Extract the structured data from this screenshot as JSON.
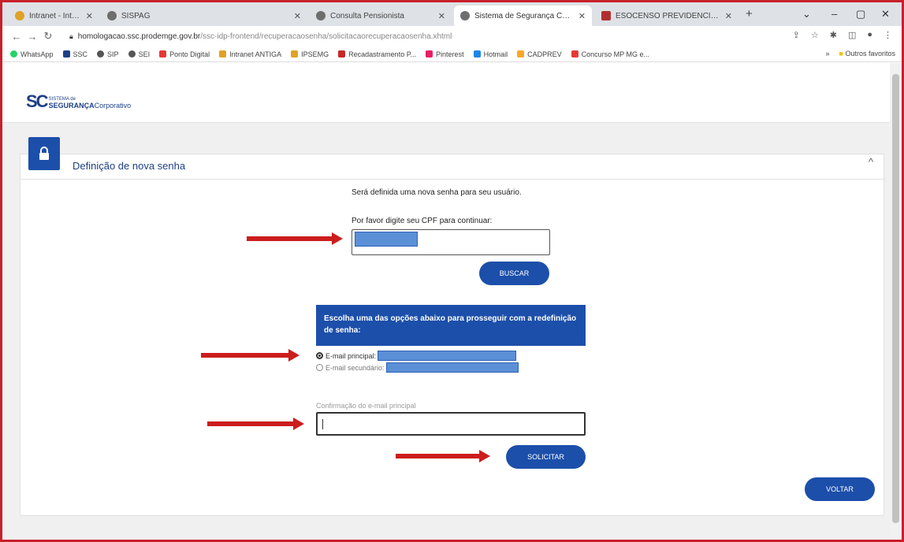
{
  "browser": {
    "tabs": [
      {
        "label": "Intranet - Intranet - Banda dkn",
        "color": "#e0a126"
      },
      {
        "label": "SISPAG",
        "color": "#6e6e6e"
      },
      {
        "label": "Consulta Pensionista",
        "color": "#6e6e6e"
      },
      {
        "label": "Sistema de Segurança Corpora",
        "color": "#6e6e6e"
      },
      {
        "label": "ESOCENSO PREVIDENCIARIO",
        "color": "#b03030"
      }
    ],
    "new_tab": "+",
    "window_controls": {
      "dropdown": "⌄",
      "minimize": "–",
      "maximize": "▢",
      "close": "✕"
    },
    "url_host": "homologacao.ssc.prodemge.gov.br",
    "url_path": "/ssc-idp-frontend/recuperacaosenha/solicitacaorecuperacaosenha.xhtml",
    "bookmarks": [
      {
        "label": "WhatsApp",
        "color": "#25d366"
      },
      {
        "label": "SSC",
        "color": "#1d3f86"
      },
      {
        "label": "SIP",
        "color": "#555555"
      },
      {
        "label": "SEI",
        "color": "#555555"
      },
      {
        "label": "Ponto Digital",
        "color": "#e53935"
      },
      {
        "label": "Intranet ANTIGA",
        "color": "#e0a126"
      },
      {
        "label": "IPSEMG",
        "color": "#e0a126"
      },
      {
        "label": "Recadastramento P...",
        "color": "#c62828"
      },
      {
        "label": "Pinterest",
        "color": "#e91e63"
      },
      {
        "label": "Hotmail",
        "color": "#1e88e5"
      },
      {
        "label": "CADPREV",
        "color": "#f9a825"
      },
      {
        "label": "Concurso MP MG e...",
        "color": "#e53935"
      }
    ],
    "other_bookmarks": "Outros favoritos"
  },
  "logo": {
    "sc": "SC",
    "small": "SISTEMA de",
    "big_bold": "SEGURANÇA",
    "big_regular": "Corporativo"
  },
  "card": {
    "title": "Definição de nova senha",
    "intro_line1": "Será definida uma nova senha para seu usuário.",
    "intro_line2": "Por favor digite seu CPF para continuar:",
    "buscar_label": "BUSCAR",
    "options_header": "Escolha uma das opções abaixo para prosseguir com a redefinição de senha:",
    "option_primary": "E-mail principal:",
    "option_secondary": "E-mail secundário:",
    "confirm_label": "Confirmação do e-mail principal",
    "solicitar_label": "SOLICITAR",
    "voltar_label": "VOLTAR"
  },
  "colors": {
    "accent": "#1c4faa",
    "annotation_frame": "#c8202a",
    "annotation_arrow": "#cc1d1d"
  }
}
